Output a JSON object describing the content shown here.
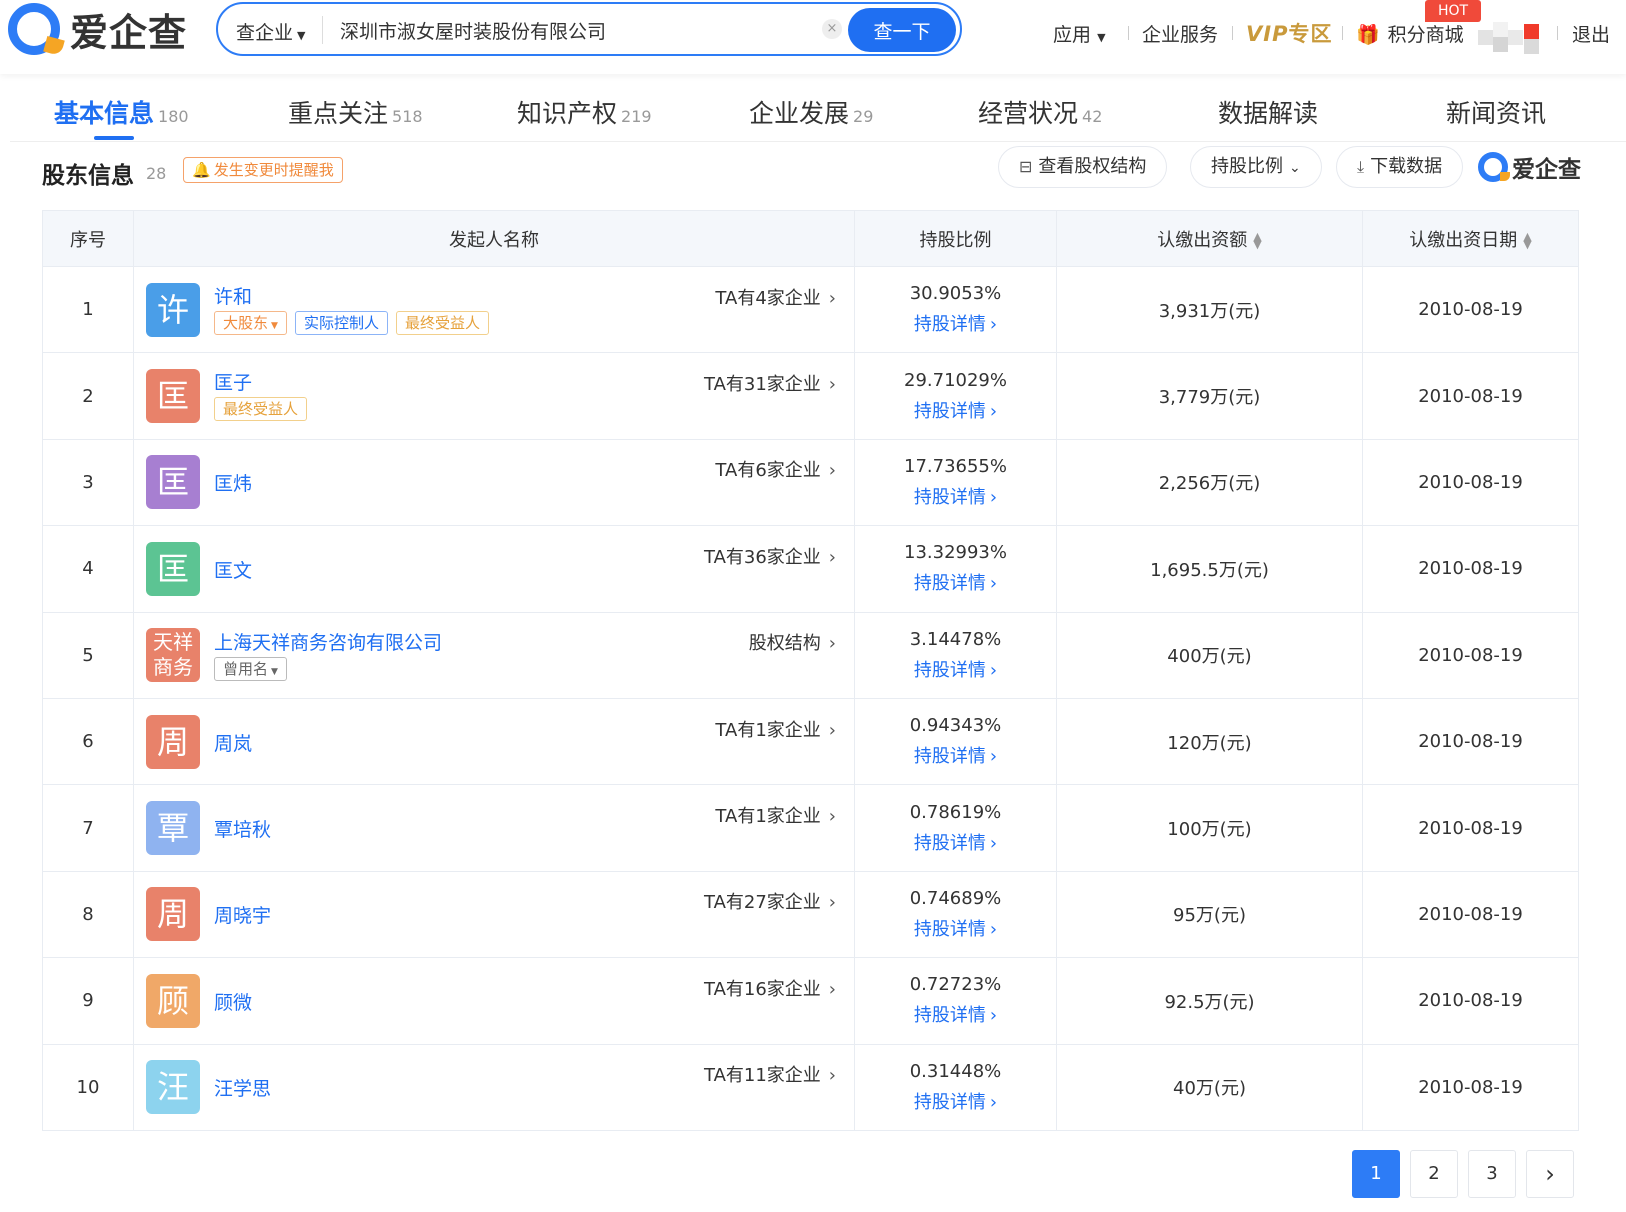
{
  "header": {
    "logo_text": "爱企查",
    "search_type": "查企业",
    "search_value": "深圳市淑女屋时装股份有限公司",
    "search_clear": "×",
    "search_button": "查一下",
    "nav": {
      "apps": "应用",
      "enterprise_service": "企业服务",
      "vip_prefix": "VIP",
      "vip_suffix": "专区",
      "points_mall": "积分商城",
      "hot": "HOT",
      "logout": "退出"
    }
  },
  "tabs": [
    {
      "label": "基本信息",
      "count": "180"
    },
    {
      "label": "重点关注",
      "count": "518"
    },
    {
      "label": "知识产权",
      "count": "219"
    },
    {
      "label": "企业发展",
      "count": "29"
    },
    {
      "label": "经营状况",
      "count": "42"
    },
    {
      "label": "数据解读",
      "count": ""
    },
    {
      "label": "新闻资讯",
      "count": ""
    }
  ],
  "section": {
    "title": "股东信息",
    "count": "28",
    "remind": "发生变更时提醒我",
    "view_structure": "查看股权结构",
    "ratio_filter": "持股比例",
    "download": "下载数据",
    "brand": "爱企查"
  },
  "table": {
    "headers": {
      "idx": "序号",
      "name": "发起人名称",
      "ratio": "持股比例",
      "amount": "认缴出资额",
      "date": "认缴出资日期"
    },
    "detail_link": "持股详情",
    "rows": [
      {
        "idx": "1",
        "avatar": "许",
        "avatar_color": "#4a9ee8",
        "name": "许和",
        "related": "TA有4家企业",
        "ratio": "30.9053%",
        "amount": "3,931万(元)",
        "date": "2010-08-19",
        "tags": [
          {
            "text": "大股东",
            "style": "orange",
            "caret": true
          },
          {
            "text": "实际控制人",
            "style": "blue",
            "caret": false
          },
          {
            "text": "最终受益人",
            "style": "yellow",
            "caret": false
          }
        ]
      },
      {
        "idx": "2",
        "avatar": "匡",
        "avatar_color": "#e8826a",
        "name": "匡子",
        "related": "TA有31家企业",
        "ratio": "29.71029%",
        "amount": "3,779万(元)",
        "date": "2010-08-19",
        "tags": [
          {
            "text": "最终受益人",
            "style": "yellow",
            "caret": false
          }
        ]
      },
      {
        "idx": "3",
        "avatar": "匡",
        "avatar_color": "#a77fd1",
        "name": "匡炜",
        "related": "TA有6家企业",
        "ratio": "17.73655%",
        "amount": "2,256万(元)",
        "date": "2010-08-19",
        "tags": []
      },
      {
        "idx": "4",
        "avatar": "匡",
        "avatar_color": "#5cc493",
        "name": "匡文",
        "related": "TA有36家企业",
        "ratio": "13.32993%",
        "amount": "1,695.5万(元)",
        "date": "2010-08-19",
        "tags": []
      },
      {
        "idx": "5",
        "avatar": "天祥商务",
        "avatar_color": "#e8826a",
        "name": "上海天祥商务咨询有限公司",
        "related": "股权结构",
        "ratio": "3.14478%",
        "amount": "400万(元)",
        "date": "2010-08-19",
        "tags": [
          {
            "text": "曾用名",
            "style": "gray",
            "caret": true
          }
        ]
      },
      {
        "idx": "6",
        "avatar": "周",
        "avatar_color": "#e8826a",
        "name": "周岚",
        "related": "TA有1家企业",
        "ratio": "0.94343%",
        "amount": "120万(元)",
        "date": "2010-08-19",
        "tags": []
      },
      {
        "idx": "7",
        "avatar": "覃",
        "avatar_color": "#8fb3f0",
        "name": "覃培秋",
        "related": "TA有1家企业",
        "ratio": "0.78619%",
        "amount": "100万(元)",
        "date": "2010-08-19",
        "tags": []
      },
      {
        "idx": "8",
        "avatar": "周",
        "avatar_color": "#e8826a",
        "name": "周晓宇",
        "related": "TA有27家企业",
        "ratio": "0.74689%",
        "amount": "95万(元)",
        "date": "2010-08-19",
        "tags": []
      },
      {
        "idx": "9",
        "avatar": "顾",
        "avatar_color": "#f0a868",
        "name": "顾微",
        "related": "TA有16家企业",
        "ratio": "0.72723%",
        "amount": "92.5万(元)",
        "date": "2010-08-19",
        "tags": []
      },
      {
        "idx": "10",
        "avatar": "汪",
        "avatar_color": "#8dd3ee",
        "name": "汪学思",
        "related": "TA有11家企业",
        "ratio": "0.31448%",
        "amount": "40万(元)",
        "date": "2010-08-19",
        "tags": []
      }
    ]
  },
  "pagination": {
    "pages": [
      "1",
      "2",
      "3"
    ],
    "current": "1",
    "next": "›"
  },
  "colors": {
    "primary": "#1f6ff2",
    "vip_gold": "#c99a3c",
    "hot_red": "#f04a3a",
    "remind_orange": "#f08a3c"
  }
}
